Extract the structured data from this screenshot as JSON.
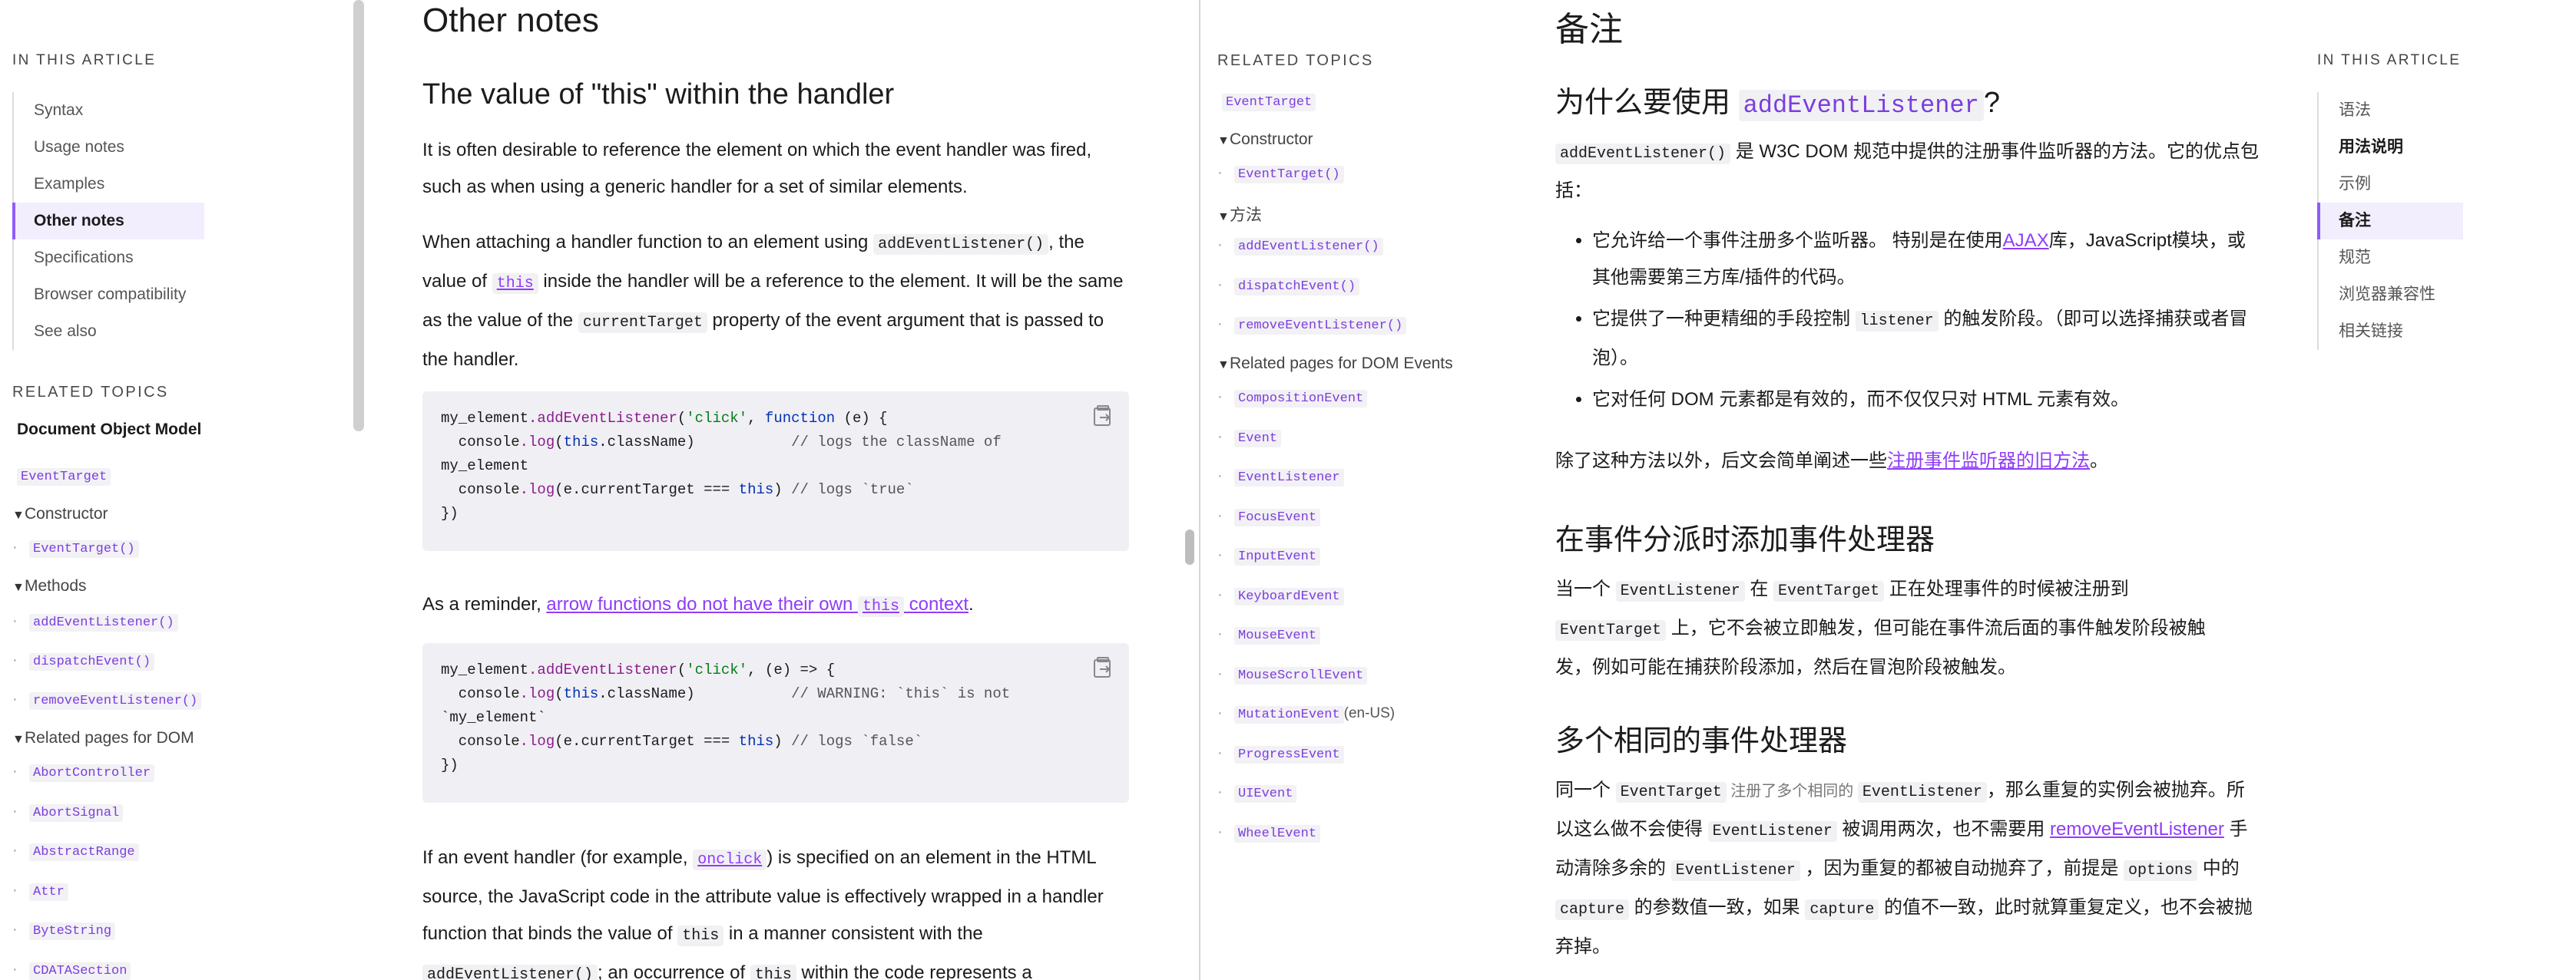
{
  "left": {
    "toc": {
      "heading": "In this article",
      "items": [
        "Syntax",
        "Usage notes",
        "Examples",
        "Other notes",
        "Specifications",
        "Browser compatibility",
        "See also"
      ],
      "active_index": 3
    },
    "related": {
      "heading": "Related topics",
      "root": "Document Object Model",
      "event_target": "EventTarget",
      "constructor_label": "Constructor",
      "constructor_items": [
        "EventTarget()"
      ],
      "methods_label": "Methods",
      "methods_items": [
        "addEventListener()",
        "dispatchEvent()",
        "removeEventListener()"
      ],
      "related_label": "Related pages for DOM",
      "related_items": [
        "AbortController",
        "AbortSignal",
        "AbstractRange",
        "Attr",
        "ByteString",
        "CDATASection"
      ]
    },
    "article": {
      "h2": "Other notes",
      "h3": "The value of \"this\" within the handler",
      "p1": "It is often desirable to reference the element on which the event handler was fired, such as when using a generic handler for a set of similar elements.",
      "p2": {
        "a": "When attaching a handler function to an element using ",
        "code1": "addEventListener()",
        "b": ", the value of ",
        "code2": "this",
        "c": " inside the handler will be a reference to the element. It will be the same as the value of the ",
        "code3": "currentTarget",
        "d": " property of the event argument that is passed to the handler."
      },
      "code1": {
        "line1_a": "my_element",
        "line1_b": ".addEventListener",
        "line1_c": "(",
        "line1_str": "'click'",
        "line1_d": ", ",
        "line1_kw": "function",
        "line1_e": " (e) {",
        "line2_a": "  console",
        "line2_b": ".log",
        "line2_c": "(",
        "line2_kw": "this",
        "line2_d": ".className)",
        "line2_cm": "           // logs the className of",
        "line3": "my_element",
        "line4_a": "  console",
        "line4_b": ".log",
        "line4_c": "(e.currentTarget === ",
        "line4_kw": "this",
        "line4_d": ")",
        "line4_cm": " // logs `true`",
        "line5": "})"
      },
      "p3": {
        "a": "As a reminder, ",
        "link_a": "arrow functions do not have their own ",
        "link_code": "this",
        "link_b": " context",
        "b": "."
      },
      "code2": {
        "line1_a": "my_element",
        "line1_b": ".addEventListener",
        "line1_c": "(",
        "line1_str": "'click'",
        "line1_d": ", (e) => {",
        "line2_a": "  console",
        "line2_b": ".log",
        "line2_c": "(",
        "line2_kw": "this",
        "line2_d": ".className)",
        "line2_cm": "           // WARNING: `this` is not",
        "line3": "`my_element`",
        "line4_a": "  console",
        "line4_b": ".log",
        "line4_c": "(e.currentTarget === ",
        "line4_kw": "this",
        "line4_d": ")",
        "line4_cm": " // logs `false`",
        "line5": "})"
      },
      "p4": {
        "a": "If an event handler (for example, ",
        "code1": "onclick",
        "b": ") is specified on an element in the HTML source, the JavaScript code in the attribute value is effectively wrapped in a handler function that binds the value of ",
        "code2": "this",
        "c": " in a manner consistent with the ",
        "code3": "addEventListener()",
        "d": "; an occurrence of ",
        "code4": "this",
        "e": " within the code represents a"
      }
    }
  },
  "right": {
    "related": {
      "heading": "Related topics",
      "event_target": "EventTarget",
      "constructor_label": "Constructor",
      "constructor_items": [
        "EventTarget()"
      ],
      "methods_label": "方法",
      "methods_items": [
        "addEventListener()",
        "dispatchEvent()",
        "removeEventListener()"
      ],
      "related_label": "Related pages for DOM Events",
      "related_items": [
        "CompositionEvent",
        "Event",
        "EventListener",
        "FocusEvent",
        "InputEvent",
        "KeyboardEvent",
        "MouseEvent",
        "MouseScrollEvent",
        "MutationEvent",
        "ProgressEvent",
        "UIEvent",
        "WheelEvent"
      ],
      "mutation_suffix": "(en-US)"
    },
    "toc": {
      "heading": "In this article",
      "items": [
        "语法",
        "用法说明",
        "示例",
        "备注",
        "规范",
        "浏览器兼容性",
        "相关链接"
      ],
      "active_index": 3
    },
    "article": {
      "h2": "备注",
      "h3a_text": "为什么要使用 ",
      "h3a_code": "addEventListener",
      "h3a_end": "?",
      "p1_code": "addEventListener()",
      "p1_text": " 是 W3C DOM 规范中提供的注册事件监听器的方法。它的优点包括：",
      "li1_a": "它允许给一个事件注册多个监听器。 特别是在使用",
      "li1_link": "AJAX",
      "li1_b": "库，JavaScript模块，或其他需要第三方库/插件的代码。",
      "li2_a": "它提供了一种更精细的手段控制 ",
      "li2_code": "listener",
      "li2_b": " 的触发阶段。（即可以选择捕获或者冒泡）。",
      "li3": "它对任何 DOM 元素都是有效的，而不仅仅只对 HTML 元素有效。",
      "p2_a": "除了这种方法以外，后文会简单阐述一些",
      "p2_link": "注册事件监听器的旧方法",
      "p2_b": "。",
      "h3b": "在事件分派时添加事件处理器",
      "p3_a": "当一个 ",
      "p3_code1": "EventListener",
      "p3_b": " 在 ",
      "p3_code2": "EventTarget",
      "p3_c": " 正在处理事件的时候被注册到 ",
      "p3_code3": "EventTarget",
      "p3_d": " 上，它不会被立即触发，但可能在事件流后面的事件触发阶段被触发，例如可能在捕获阶段添加，然后在冒泡阶段被触发。",
      "h3c": "多个相同的事件处理器",
      "p4_a": "同一个 ",
      "p4_code1": "EventTarget",
      "p4_grey": " 注册了多个相同的 ",
      "p4_code2": "EventListener",
      "p4_b": "，那么重复的实例会被抛弃。所以这么做不会使得 ",
      "p4_code3": "EventListener",
      "p4_c": " 被调用两次，也不需要用 ",
      "p4_link": "removeEventListener",
      "p4_d": " 手动清除多余的 ",
      "p4_code4": "EventListener",
      "p4_e": " ，因为重复的都被自动抛弃了，前提是 ",
      "p4_code5": "options",
      "p4_f": " 中的 ",
      "p4_code6": "capture",
      "p4_g": " 的参数值一致，如果 ",
      "p4_code7": "capture",
      "p4_h": " 的值不一致，此时就算重复定义，也不会被抛弃掉。"
    }
  }
}
